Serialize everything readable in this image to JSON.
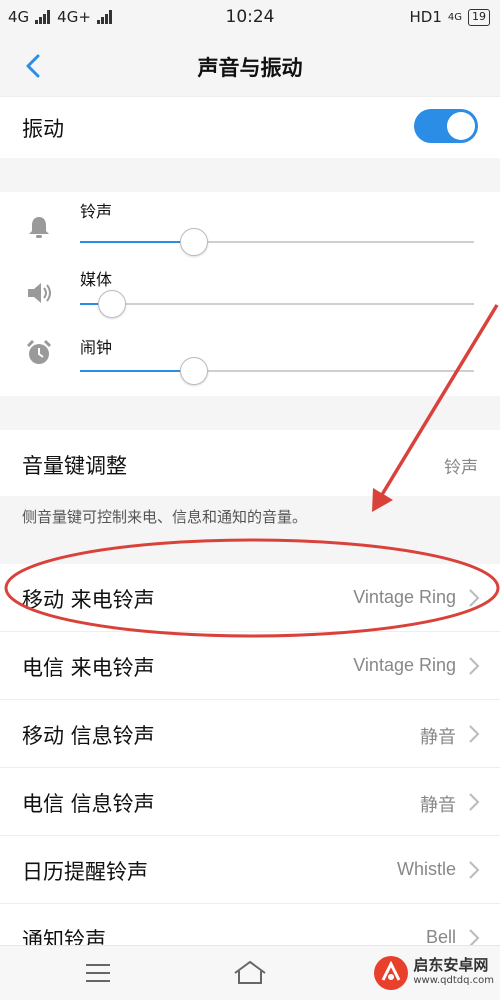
{
  "status_bar": {
    "signal_left": "4G",
    "signal_right": "4G+",
    "time": "10:24",
    "hd": "HD1",
    "net": "4G",
    "battery": "19"
  },
  "header": {
    "title": "声音与振动"
  },
  "vibration": {
    "label": "振动",
    "enabled": true
  },
  "volumes": [
    {
      "label": "铃声",
      "icon": "bell-icon",
      "level": 0.29
    },
    {
      "label": "媒体",
      "icon": "speaker-icon",
      "level": 0.08
    },
    {
      "label": "闹钟",
      "icon": "alarm-clock-icon",
      "level": 0.29
    }
  ],
  "volume_key": {
    "label": "音量键调整",
    "value": "铃声",
    "hint": "侧音量键可控制来电、信息和通知的音量。"
  },
  "ringtones": [
    {
      "label": "移动 来电铃声",
      "value": "Vintage Ring"
    },
    {
      "label": "电信 来电铃声",
      "value": "Vintage Ring"
    },
    {
      "label": "移动 信息铃声",
      "value": "静音"
    },
    {
      "label": "电信 信息铃声",
      "value": "静音"
    },
    {
      "label": "日历提醒铃声",
      "value": "Whistle"
    },
    {
      "label": "通知铃声",
      "value": "Bell"
    }
  ],
  "watermark": {
    "name": "启东安卓网",
    "url": "www.qdtdq.com"
  },
  "colors": {
    "accent": "#2b8de6",
    "annotation": "#d9423a"
  }
}
